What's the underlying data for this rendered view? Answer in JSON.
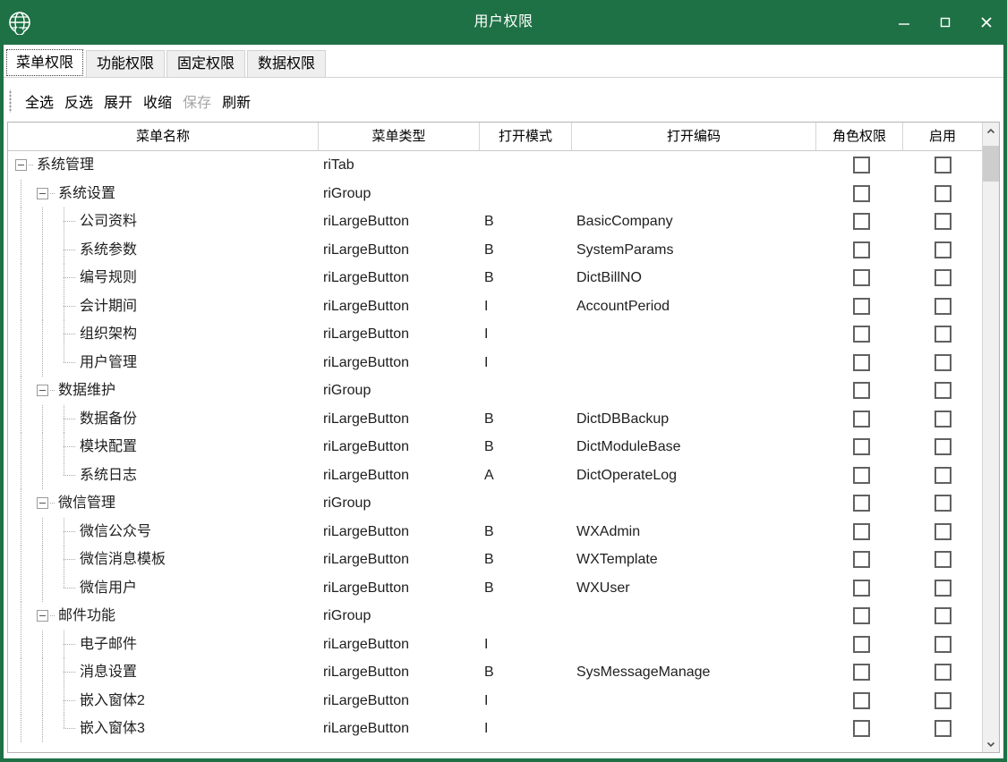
{
  "window": {
    "title": "用户权限",
    "icon": "globe-icon",
    "accent_color": "#1e7145",
    "minimize_label": "—",
    "maximize_label": "▭",
    "close_label": "✕"
  },
  "tabs": [
    {
      "label": "菜单权限",
      "active": true
    },
    {
      "label": "功能权限",
      "active": false
    },
    {
      "label": "固定权限",
      "active": false
    },
    {
      "label": "数据权限",
      "active": false
    }
  ],
  "toolbar": {
    "buttons": [
      {
        "label": "全选",
        "disabled": false
      },
      {
        "label": "反选",
        "disabled": false
      },
      {
        "label": "展开",
        "disabled": false
      },
      {
        "label": "收缩",
        "disabled": false
      },
      {
        "label": "保存",
        "disabled": true
      },
      {
        "label": "刷新",
        "disabled": false
      }
    ]
  },
  "grid": {
    "columns": [
      {
        "label": "菜单名称",
        "key": "name"
      },
      {
        "label": "菜单类型",
        "key": "type"
      },
      {
        "label": "打开模式",
        "key": "mode"
      },
      {
        "label": "打开编码",
        "key": "code"
      },
      {
        "label": "角色权限",
        "key": "role"
      },
      {
        "label": "启用",
        "key": "enable"
      }
    ],
    "rows": [
      {
        "level": 0,
        "expander": "expanded",
        "name": "系统管理",
        "type": "riTab",
        "mode": "",
        "code": "",
        "role_checked": false,
        "enable_checked": false
      },
      {
        "level": 1,
        "expander": "expanded",
        "name": "系统设置",
        "type": "riGroup",
        "mode": "",
        "code": "",
        "role_checked": false,
        "enable_checked": false
      },
      {
        "level": 2,
        "expander": "none",
        "name": "公司资料",
        "type": "riLargeButton",
        "mode": "B",
        "code": "BasicCompany",
        "role_checked": false,
        "enable_checked": false
      },
      {
        "level": 2,
        "expander": "none",
        "name": "系统参数",
        "type": "riLargeButton",
        "mode": "B",
        "code": "SystemParams",
        "role_checked": false,
        "enable_checked": false
      },
      {
        "level": 2,
        "expander": "none",
        "name": "编号规则",
        "type": "riLargeButton",
        "mode": "B",
        "code": "DictBillNO",
        "role_checked": false,
        "enable_checked": false
      },
      {
        "level": 2,
        "expander": "none",
        "name": "会计期间",
        "type": "riLargeButton",
        "mode": "I",
        "code": "AccountPeriod",
        "role_checked": false,
        "enable_checked": false
      },
      {
        "level": 2,
        "expander": "none",
        "name": "组织架构",
        "type": "riLargeButton",
        "mode": "I",
        "code": "",
        "role_checked": false,
        "enable_checked": false
      },
      {
        "level": 2,
        "expander": "none",
        "name": "用户管理",
        "type": "riLargeButton",
        "mode": "I",
        "code": "",
        "role_checked": false,
        "enable_checked": false
      },
      {
        "level": 1,
        "expander": "expanded",
        "name": "数据维护",
        "type": "riGroup",
        "mode": "",
        "code": "",
        "role_checked": false,
        "enable_checked": false
      },
      {
        "level": 2,
        "expander": "none",
        "name": "数据备份",
        "type": "riLargeButton",
        "mode": "B",
        "code": "DictDBBackup",
        "role_checked": false,
        "enable_checked": false
      },
      {
        "level": 2,
        "expander": "none",
        "name": "模块配置",
        "type": "riLargeButton",
        "mode": "B",
        "code": "DictModuleBase",
        "role_checked": false,
        "enable_checked": false
      },
      {
        "level": 2,
        "expander": "none",
        "name": "系统日志",
        "type": "riLargeButton",
        "mode": "A",
        "code": "DictOperateLog",
        "role_checked": false,
        "enable_checked": false
      },
      {
        "level": 1,
        "expander": "expanded",
        "name": "微信管理",
        "type": "riGroup",
        "mode": "",
        "code": "",
        "role_checked": false,
        "enable_checked": false
      },
      {
        "level": 2,
        "expander": "none",
        "name": "微信公众号",
        "type": "riLargeButton",
        "mode": "B",
        "code": "WXAdmin",
        "role_checked": false,
        "enable_checked": false
      },
      {
        "level": 2,
        "expander": "none",
        "name": "微信消息模板",
        "type": "riLargeButton",
        "mode": "B",
        "code": "WXTemplate",
        "role_checked": false,
        "enable_checked": false
      },
      {
        "level": 2,
        "expander": "none",
        "name": "微信用户",
        "type": "riLargeButton",
        "mode": "B",
        "code": "WXUser",
        "role_checked": false,
        "enable_checked": false
      },
      {
        "level": 1,
        "expander": "expanded",
        "name": "邮件功能",
        "type": "riGroup",
        "mode": "",
        "code": "",
        "role_checked": false,
        "enable_checked": false
      },
      {
        "level": 2,
        "expander": "none",
        "name": "电子邮件",
        "type": "riLargeButton",
        "mode": "I",
        "code": "",
        "role_checked": false,
        "enable_checked": false
      },
      {
        "level": 2,
        "expander": "none",
        "name": "消息设置",
        "type": "riLargeButton",
        "mode": "B",
        "code": "SysMessageManage",
        "role_checked": false,
        "enable_checked": false
      },
      {
        "level": 2,
        "expander": "none",
        "name": "嵌入窗体2",
        "type": "riLargeButton",
        "mode": "I",
        "code": "",
        "role_checked": false,
        "enable_checked": false
      },
      {
        "level": 2,
        "expander": "none",
        "name": "嵌入窗体3",
        "type": "riLargeButton",
        "mode": "I",
        "code": "",
        "role_checked": false,
        "enable_checked": false
      }
    ]
  },
  "scrollbar": {
    "up_arrow": "chevron-up-icon",
    "down_arrow": "chevron-down-icon",
    "thumb_top_pct": 1,
    "thumb_height_pct": 6
  }
}
